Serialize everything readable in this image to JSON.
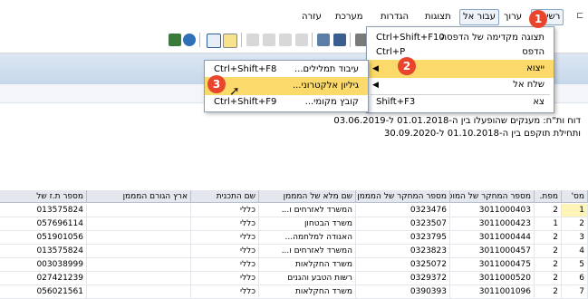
{
  "menubar": {
    "items": [
      {
        "label": "רשימה",
        "selected": true
      },
      {
        "label": "ערוך"
      },
      {
        "label": "עבור אל",
        "selected": true
      },
      {
        "label": "תצוגות"
      },
      {
        "label": "הגדרות"
      },
      {
        "label": "מערכת"
      },
      {
        "label": "עזרה"
      }
    ]
  },
  "report": {
    "line1": "דוח ות\"ח: מענקים שהופעלו בין ה-01.01.2018 ל-03.06.2019",
    "line2": "ותחילת תוקפם בין ה-01.10.2018 ל-30.09.2020"
  },
  "main_menu": {
    "items": [
      {
        "label": "תצוגה מקדימה של הדפסה",
        "shortcut": "Ctrl+Shift+F10"
      },
      {
        "label": "הדפס",
        "shortcut": "Ctrl+P"
      },
      {
        "label": "ייצוא",
        "shortcut": "",
        "submenu": true,
        "highlighted": true
      },
      {
        "label": "שלח אל",
        "shortcut": "",
        "submenu": true
      },
      {
        "label": "צא",
        "shortcut": "Shift+F3"
      }
    ]
  },
  "sub_menu": {
    "items": [
      {
        "label": "עיבוד תמלילים...",
        "shortcut": "Ctrl+Shift+F8"
      },
      {
        "label": "גיליון אלקטרוני...",
        "shortcut": "",
        "highlighted": true
      },
      {
        "label": "קובץ מקומי...",
        "shortcut": "Ctrl+Shift+F9"
      }
    ]
  },
  "badges": [
    "1",
    "2",
    "3"
  ],
  "table": {
    "headers": [
      "מס'",
      "מפת.",
      "מספר המחקר של המוסד",
      "מספר המחקר של המממן",
      "שם מלא של המממן",
      "שם התכנית",
      "ארץ הגורם המממן",
      "מספר ת.ז של"
    ],
    "rows": [
      [
        "1",
        "2",
        "3011000403",
        "0323476",
        "המשרד לאזרחים ו...",
        "כללי",
        "",
        "013575824"
      ],
      [
        "2",
        "1",
        "3011000423",
        "0323507",
        "משרד הבטחון",
        "כללי",
        "",
        "057696114"
      ],
      [
        "3",
        "2",
        "3011000444",
        "0323795",
        "האגודה למלחמה...",
        "כללי",
        "",
        "051901056"
      ],
      [
        "4",
        "2",
        "3011000457",
        "0323823",
        "המשרד לאזרחים ו...",
        "כללי",
        "",
        "013575824"
      ],
      [
        "5",
        "2",
        "3011000475",
        "0325072",
        "משרד החקלאות",
        "כללי",
        "",
        "003038999"
      ],
      [
        "6",
        "2",
        "3011000520",
        "0329372",
        "רשות הטבע והגנים",
        "כללי",
        "",
        "027421239"
      ],
      [
        "7",
        "2",
        "3011001096",
        "0390393",
        "משרד החקלאות",
        "כללי",
        "",
        "056021561"
      ]
    ]
  },
  "colors": {
    "highlight": "#fbd96a",
    "badge": "#e8452c",
    "header": "#e4e8ee"
  }
}
